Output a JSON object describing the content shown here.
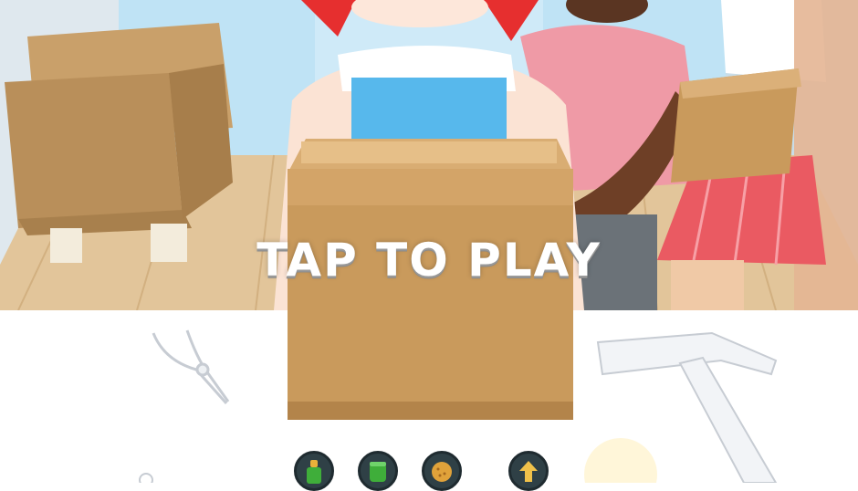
{
  "overlay": {
    "prompt": "TAP TO PLAY"
  },
  "scene": {
    "items": [
      {
        "name": "armchair-prop"
      },
      {
        "name": "cardboard-box"
      },
      {
        "name": "pliers-tool"
      },
      {
        "name": "hammer-tool"
      }
    ]
  },
  "tray": {
    "buttons": [
      {
        "icon": "paint-bottle-icon",
        "color": "#e9b13a"
      },
      {
        "icon": "green-jar-icon",
        "color": "#3fae3a"
      },
      {
        "icon": "cookie-icon",
        "color": "#e0a23a"
      },
      {
        "icon": "upload-arrow-icon",
        "color": "#f0c14a"
      }
    ]
  },
  "colors": {
    "box": "#c99a5c",
    "floor": "#d9b98c",
    "sky": "#bfe3f5",
    "table": "#ffffff"
  }
}
